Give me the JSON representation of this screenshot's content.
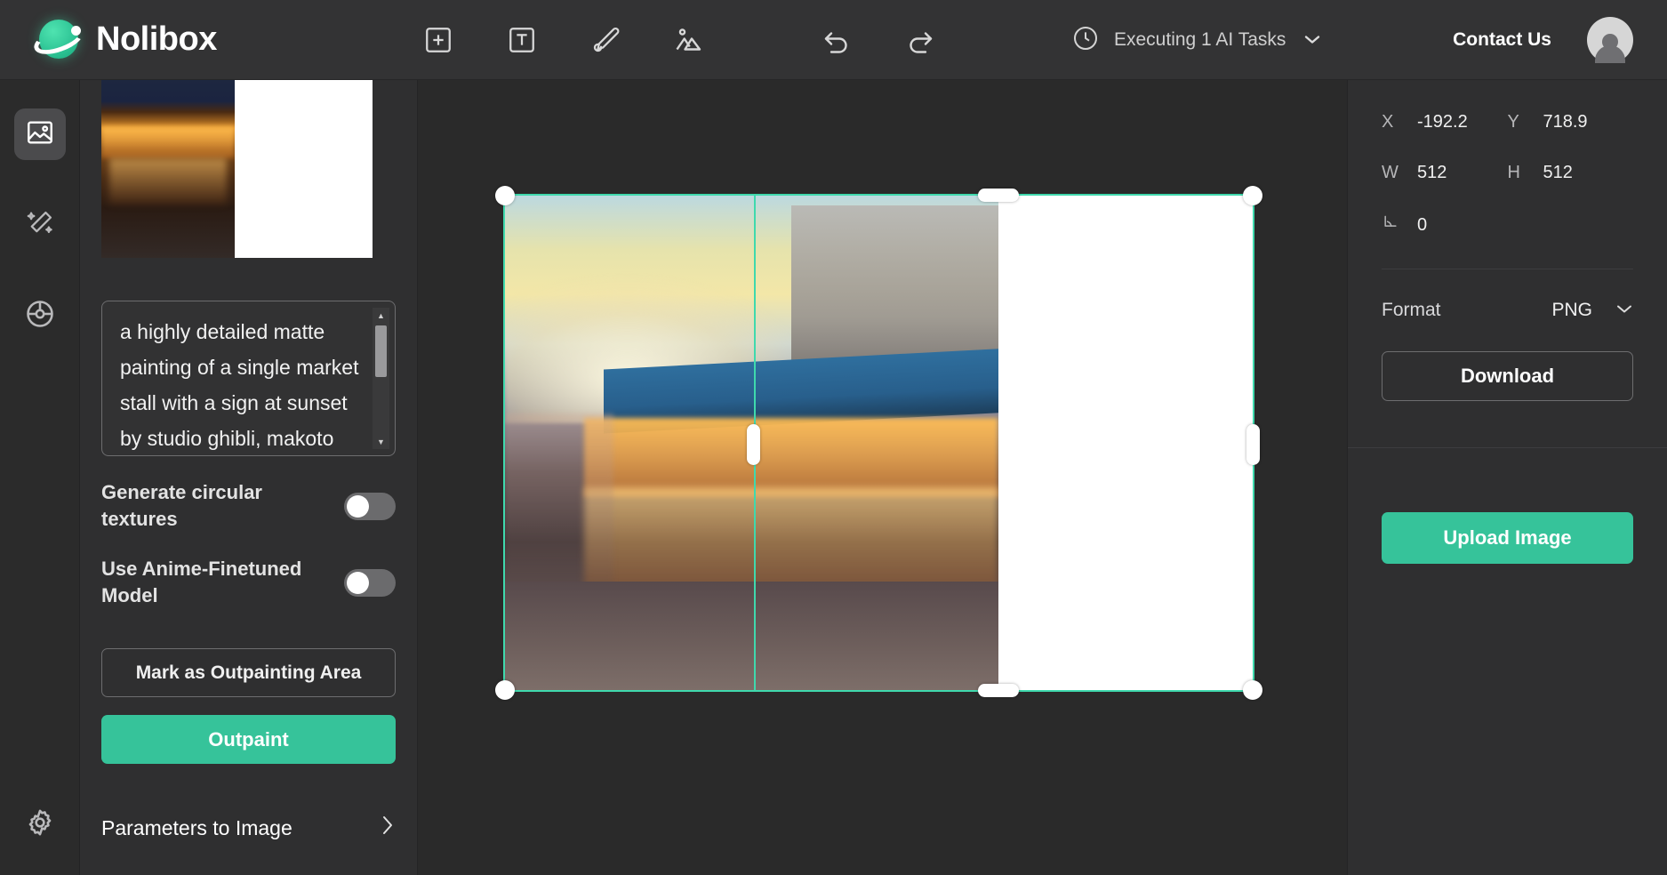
{
  "header": {
    "brand": "Nolibox",
    "tools": [
      {
        "name": "add-element",
        "icon": "plus-square-icon"
      },
      {
        "name": "add-text",
        "icon": "text-box-icon"
      },
      {
        "name": "brush",
        "icon": "brush-icon"
      },
      {
        "name": "add-image",
        "icon": "image-mountain-icon"
      }
    ],
    "undo_icon": "undo-icon",
    "redo_icon": "redo-icon",
    "task_status": "Executing 1 AI Tasks",
    "task_icon": "clock-icon",
    "task_caret": "❯",
    "contact": "Contact Us",
    "avatar_icon": "user-avatar-icon"
  },
  "rail": {
    "items": [
      {
        "name": "image-tool",
        "icon": "image-icon",
        "active": true
      },
      {
        "name": "magic-wand-tool",
        "icon": "magic-wand-icon",
        "active": false
      },
      {
        "name": "palette-tool",
        "icon": "color-wheel-icon",
        "active": false
      }
    ],
    "settings": {
      "name": "settings",
      "icon": "gear-icon"
    }
  },
  "panel": {
    "prompt": "a highly detailed matte painting of a single market stall with a sign at sunset by studio ghibli, makoto shinkai,",
    "scroll_up": "▲",
    "scroll_down": "▼",
    "toggles": [
      {
        "label": "Generate circular textures",
        "on": false
      },
      {
        "label": "Use Anime-Finetuned Model",
        "on": false
      }
    ],
    "mark_button": "Mark as Outpainting Area",
    "outpaint_button": "Outpaint",
    "params_link": "Parameters to Image",
    "params_chevron": "❯"
  },
  "right": {
    "transform": [
      {
        "key": "X",
        "value": "-192.2"
      },
      {
        "key": "Y",
        "value": "718.9"
      },
      {
        "key": "W",
        "value": "512"
      },
      {
        "key": "H",
        "value": "512"
      },
      {
        "key": "∠",
        "value": "0"
      }
    ],
    "format_label": "Format",
    "format_value": "PNG",
    "format_caret": "⌄",
    "download_button": "Download",
    "upload_button": "Upload Image"
  },
  "colors": {
    "accent": "#36c39a",
    "selection": "#3fd9ad",
    "panel_bg": "#2f2f30",
    "canvas_bg": "#2b2b2b",
    "topbar_bg": "#333334"
  }
}
